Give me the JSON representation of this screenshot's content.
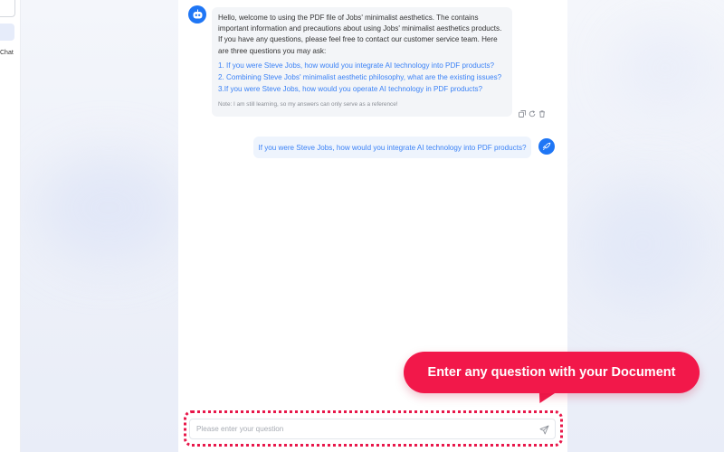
{
  "sidebar": {
    "chat_label": "Chat"
  },
  "conversation": {
    "bot_message": {
      "intro": "Hello, welcome to using the PDF file of Jobs' minimalist aesthetics. The contains important information and precautions about using Jobs' minimalist aesthetics products. If you have any questions, please feel free to contact our customer service team. Here are three questions you may ask:",
      "questions": [
        "1. If you were Steve Jobs, how would you integrate AI technology into PDF products?",
        "2. Combining Steve Jobs' minimalist aesthetic philosophy, what are the existing issues?",
        "3.If you were Steve Jobs, how would you operate AI technology in PDF products?"
      ],
      "note": "Note: I am still learning, so my answers can only serve as a reference!"
    },
    "actions": [
      "copy-icon",
      "refresh-icon",
      "delete-icon"
    ],
    "user_message": "If you were Steve Jobs, how would you integrate AI technology into PDF products?"
  },
  "callout": {
    "text": "Enter any question with your Document"
  },
  "input": {
    "placeholder": "Please enter your question",
    "value": ""
  },
  "colors": {
    "accent_blue": "#1f76f5",
    "link_blue": "#3b82f6",
    "callout_red": "#f2184a",
    "bot_bubble": "#f3f5f8",
    "user_bubble": "#eef4fd"
  }
}
